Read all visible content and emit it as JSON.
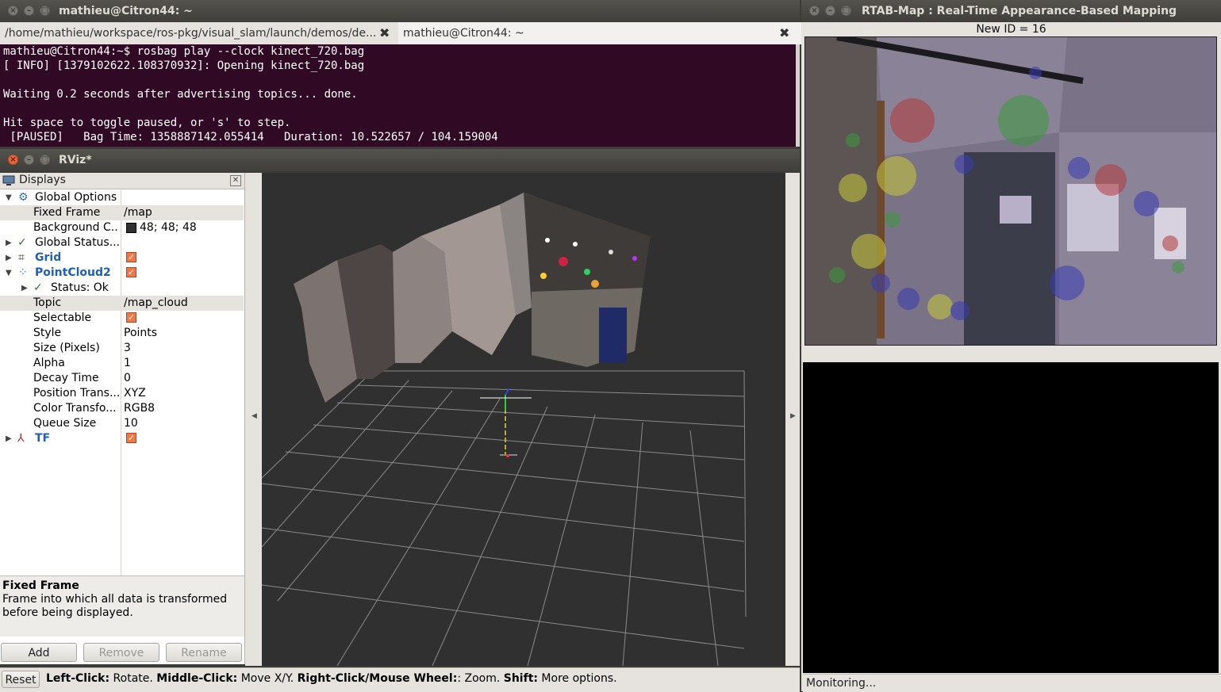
{
  "terminal": {
    "window_title": "mathieu@Citron44: ~",
    "tabs": [
      {
        "label": "/home/mathieu/workspace/ros-pkg/visual_slam/launch/demos/de...",
        "close": "✖"
      },
      {
        "label": "mathieu@Citron44: ~",
        "close": "✖"
      }
    ],
    "lines": [
      "mathieu@Citron44:~$ rosbag play --clock kinect_720.bag",
      "[ INFO] [1379102622.108370932]: Opening kinect_720.bag",
      "",
      "Waiting 0.2 seconds after advertising topics... done.",
      "",
      "Hit space to toggle paused, or 's' to step.",
      " [PAUSED]   Bag Time: 1358887142.055414   Duration: 10.522657 / 104.159004"
    ]
  },
  "rviz": {
    "window_title": "RViz*",
    "panel_title": "Displays",
    "tree": [
      {
        "name": "Global Options",
        "value": ""
      },
      {
        "name": "Fixed Frame",
        "value": "/map"
      },
      {
        "name": "Background C...",
        "value": "48; 48; 48"
      },
      {
        "name": "Global Status...",
        "value": ""
      },
      {
        "name": "Grid",
        "value": ""
      },
      {
        "name": "PointCloud2",
        "value": ""
      },
      {
        "name": "Status: Ok",
        "value": ""
      },
      {
        "name": "Topic",
        "value": "/map_cloud"
      },
      {
        "name": "Selectable",
        "value": ""
      },
      {
        "name": "Style",
        "value": "Points"
      },
      {
        "name": "Size (Pixels)",
        "value": "3"
      },
      {
        "name": "Alpha",
        "value": "1"
      },
      {
        "name": "Decay Time",
        "value": "0"
      },
      {
        "name": "Position Trans...",
        "value": "XYZ"
      },
      {
        "name": "Color Transfo...",
        "value": "RGB8"
      },
      {
        "name": "Queue Size",
        "value": "10"
      },
      {
        "name": "TF",
        "value": ""
      }
    ],
    "description": {
      "title": "Fixed Frame",
      "text_line1": "Frame into which all data is transformed",
      "text_line2": "before being displayed."
    },
    "buttons": {
      "add": "Add",
      "remove": "Remove",
      "rename": "Rename"
    },
    "status": {
      "reset": "Reset",
      "k1": "Left-Click:",
      "v1": " Rotate. ",
      "k2": "Middle-Click:",
      "v2": " Move X/Y. ",
      "k3": "Right-Click/Mouse Wheel:",
      "v3": ": Zoom. ",
      "k4": "Shift:",
      "v4": " More options."
    }
  },
  "rtabmap": {
    "window_title": "RTAB-Map : Real-Time Appearance-Based Mapping",
    "new_id": "New ID = 16",
    "status": "Monitoring..."
  },
  "colors": {
    "terminal_bg": "#300a24",
    "viewport_bg": "#303030",
    "accent_orange": "#f07746",
    "link_blue": "#1e5fb8"
  }
}
